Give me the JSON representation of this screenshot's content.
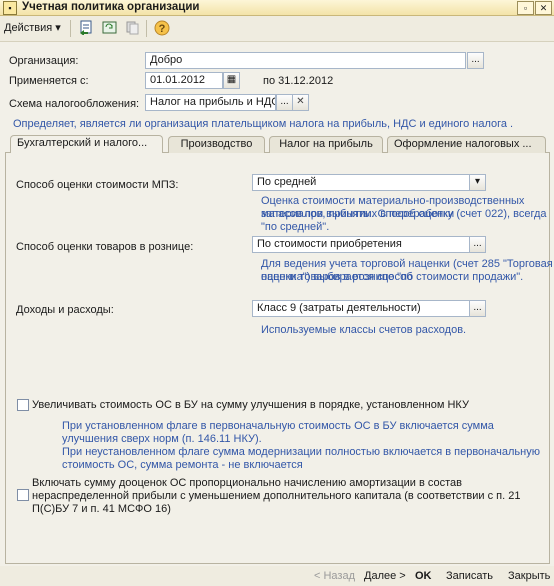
{
  "window": {
    "title": "Учетная политика организации"
  },
  "toolbar": {
    "actions_label": "Действия",
    "actions_arrow": "▾"
  },
  "form": {
    "organization_label": "Организация:",
    "organization_value": "Добро",
    "applies_label": "Применяется с:",
    "applies_value": "01.01.2012",
    "applies_to": "по 31.12.2012",
    "tax_scheme_label": "Схема налогообложения:",
    "tax_scheme_value": "Налог на прибыль и НДС",
    "tax_scheme_hint": "Определяет, является ли организация плательщиком налога на прибыль, НДС и единого налога ."
  },
  "tabs": [
    {
      "label": "Бухгалтерский  и налого..."
    },
    {
      "label": "Производство"
    },
    {
      "label": "Налог на прибыль"
    },
    {
      "label": "Оформление налоговых ..."
    }
  ],
  "accounting": {
    "mpz_label": "Способ оценки стоимости МПЗ:",
    "mpz_value": "По средней",
    "mpz_hint1": "Оценка стоимости материально-производственных запасов при выбытии. Способ оценки",
    "mpz_hint2": "материалов, принятых в переработку (счет 022), всегда \"по средней\".",
    "retail_label": "Способ оценки товаров в рознице:",
    "retail_value": "По стоимости приобретения",
    "retail_hint1": "Для ведения учета торговой наценки (счет 285 \"Торговая наценка\") выбирается способ",
    "retail_hint2": "оценки товаров в рознице \"по стоимости продажи\".",
    "income_label": "Доходы и расходы:",
    "income_value": "Класс 9 (затраты деятельности)",
    "income_hint": "Используемые классы счетов расходов.",
    "os_check_label": "Увеличивать стоимость ОС в БУ на сумму улучшения в порядке, установленном НКУ",
    "os_hint1": "При установленном флаге в первоначальную стоимость ОС в БУ включается сумма",
    "os_hint2": "улучшения сверх норм (п. 146.11 НКУ).",
    "os_hint3": "При неустановленном флаге сумма модернизации полностью включается в первоначальную",
    "os_hint4": "стоимость ОС, сумма ремонта - не включается",
    "reval_line1": "Включать сумму дооценок ОС пропорционально начислению амортизации в состав",
    "reval_line2": "нераспределенной прибыли с уменьшением дополнительного капитала (в соответствии с п. 21",
    "reval_line3": "П(С)БУ 7 и п. 41 МСФО 16)"
  },
  "bottom": {
    "back": "< Назад",
    "next": "Далее >",
    "ok": "OK",
    "save": "Записать",
    "close": "Закрыть"
  }
}
